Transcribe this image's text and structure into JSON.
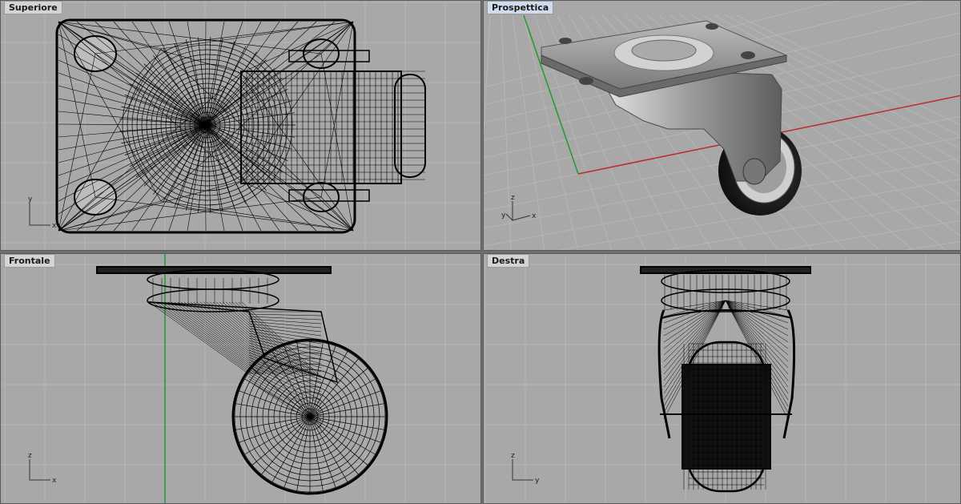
{
  "viewports": {
    "top": {
      "label": "Superiore",
      "axis_h": "x",
      "axis_v": "y"
    },
    "perspective": {
      "label": "Prospettica",
      "axis_h": "x",
      "axis_v": "z",
      "axis_d": "y"
    },
    "front": {
      "label": "Frontale",
      "axis_h": "x",
      "axis_v": "z"
    },
    "right": {
      "label": "Destra",
      "axis_h": "y",
      "axis_v": "z"
    }
  },
  "colors": {
    "viewport_bg": "#a8a8a8",
    "grid_line": "#b6b6b6",
    "wire": "#000000",
    "axis_x": "#c0282a",
    "axis_y": "#1f9b2f",
    "active_label": "#cfdcee"
  },
  "object": "swivel-caster-wheel"
}
